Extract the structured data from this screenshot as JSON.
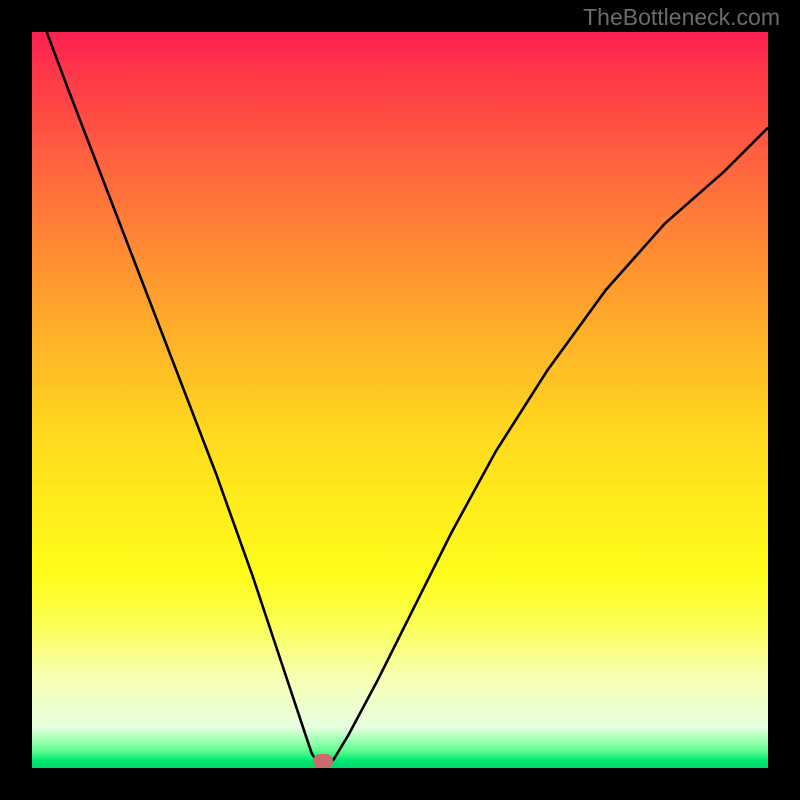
{
  "watermark": "TheBottleneck.com",
  "colors": {
    "frame": "#000000",
    "curve_stroke": "#000000",
    "marker": "#cc6b6a"
  },
  "chart_data": {
    "type": "line",
    "title": "",
    "xlabel": "",
    "ylabel": "",
    "xlim": [
      0,
      100
    ],
    "ylim": [
      0,
      100
    ],
    "grid": false,
    "series": [
      {
        "name": "bottleneck-curve",
        "x": [
          2,
          5,
          10,
          15,
          20,
          25,
          30,
          33,
          35,
          37,
          38,
          39,
          39.5,
          40,
          41,
          43,
          47,
          52,
          57,
          63,
          70,
          78,
          86,
          94,
          100
        ],
        "y": [
          100,
          92,
          79,
          66,
          53,
          40,
          26,
          17,
          11,
          5,
          2,
          0.5,
          0.2,
          0.3,
          1.2,
          4.5,
          12,
          22,
          32,
          43,
          54,
          65,
          74,
          81,
          87
        ]
      }
    ],
    "marker": {
      "x": 39.5,
      "y": 0.2,
      "label": "optimal-point"
    },
    "gradient_stops": [
      {
        "pos": 0,
        "color": "#fe2050"
      },
      {
        "pos": 0.25,
        "color": "#ff7c38"
      },
      {
        "pos": 0.55,
        "color": "#ffdb1e"
      },
      {
        "pos": 0.8,
        "color": "#fcff4f"
      },
      {
        "pos": 0.97,
        "color": "#66ff92"
      },
      {
        "pos": 1.0,
        "color": "#00d86e"
      }
    ]
  }
}
